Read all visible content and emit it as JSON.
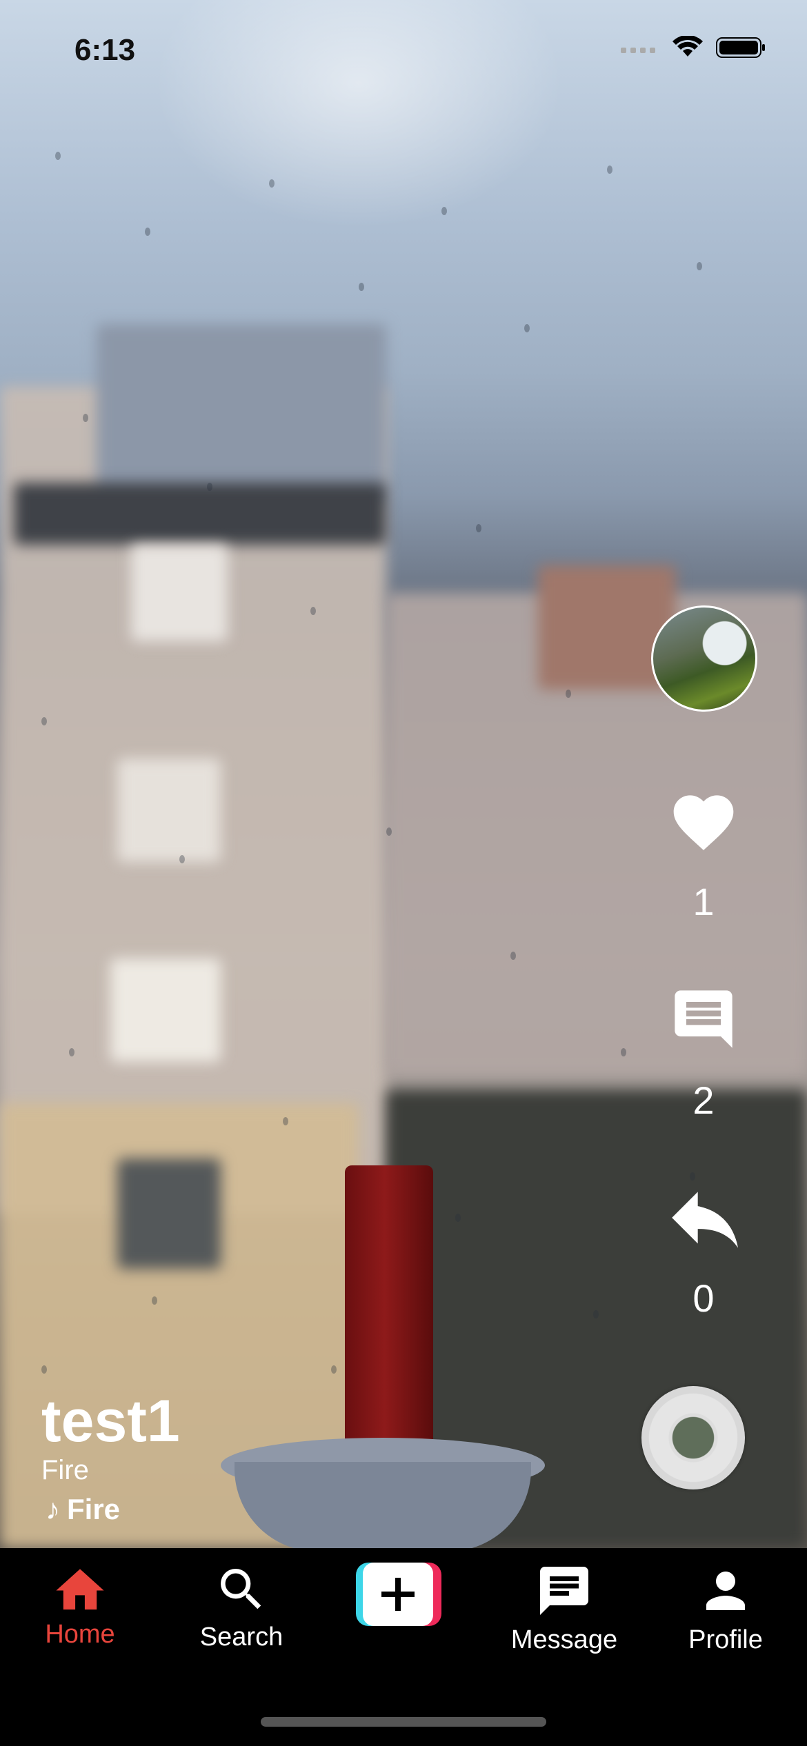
{
  "status_bar": {
    "time": "6:13"
  },
  "video": {
    "author_username": "test1",
    "caption": "Fire",
    "music_title": "Fire"
  },
  "actions": {
    "likes": "1",
    "comments": "2",
    "shares": "0"
  },
  "tabs": [
    {
      "label": "Home",
      "icon": "home-icon",
      "active": true
    },
    {
      "label": "Search",
      "icon": "search-icon",
      "active": false
    },
    {
      "label": "",
      "icon": "plus-icon",
      "active": false
    },
    {
      "label": "Message",
      "icon": "message-icon",
      "active": false
    },
    {
      "label": "Profile",
      "icon": "profile-icon",
      "active": false
    }
  ],
  "colors": {
    "active_tab": "#e8453c",
    "tab_bar": "#000000",
    "accent_cyan": "#3dd6e8",
    "accent_pink": "#ee2a5a"
  }
}
